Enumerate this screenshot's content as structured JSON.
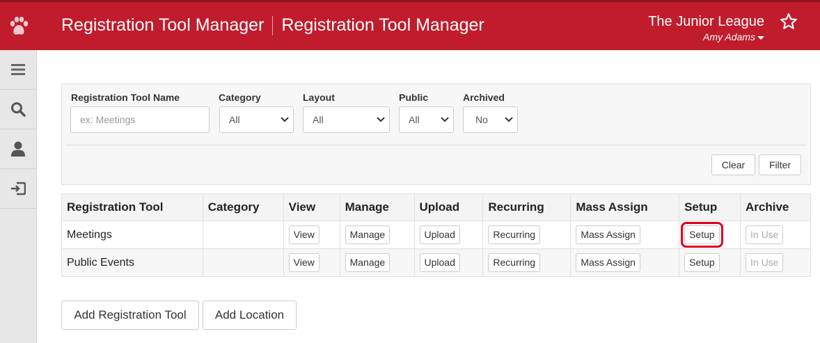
{
  "header": {
    "title_left": "Registration Tool Manager",
    "title_right": "Registration Tool Manager",
    "org_name": "The Junior League",
    "user_name": "Amy Adams",
    "brand_color": "#c01c2c"
  },
  "sidebar": {
    "items": [
      {
        "icon": "menu-icon"
      },
      {
        "icon": "search-icon"
      },
      {
        "icon": "user-icon"
      },
      {
        "icon": "login-icon"
      }
    ]
  },
  "filters": {
    "name_label": "Registration Tool Name",
    "name_placeholder": "ex: Meetings",
    "category_label": "Category",
    "category_value": "All",
    "layout_label": "Layout",
    "layout_value": "All",
    "public_label": "Public",
    "public_value": "All",
    "archived_label": "Archived",
    "archived_value": "No",
    "clear_label": "Clear",
    "filter_label": "Filter"
  },
  "table": {
    "headers": [
      "Registration Tool",
      "Category",
      "View",
      "Manage",
      "Upload",
      "Recurring",
      "Mass Assign",
      "Setup",
      "Archive"
    ],
    "rows": [
      {
        "name": "Meetings",
        "category": "",
        "view": "View",
        "manage": "Manage",
        "upload": "Upload",
        "recurring": "Recurring",
        "mass_assign": "Mass Assign",
        "setup": "Setup",
        "archive": "In Use"
      },
      {
        "name": "Public Events",
        "category": "",
        "view": "View",
        "manage": "Manage",
        "upload": "Upload",
        "recurring": "Recurring",
        "mass_assign": "Mass Assign",
        "setup": "Setup",
        "archive": "In Use"
      }
    ]
  },
  "actions": {
    "add_tool": "Add Registration Tool",
    "add_location": "Add Location"
  }
}
